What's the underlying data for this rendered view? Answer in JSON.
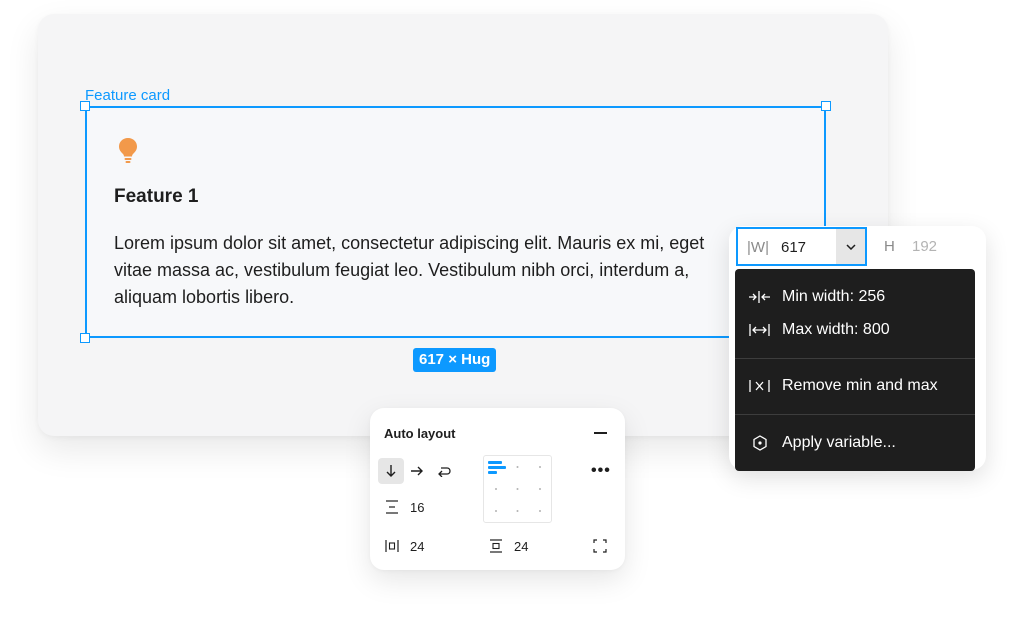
{
  "frame": {
    "label": "Feature card",
    "card_title": "Feature 1",
    "card_body": "Lorem ipsum dolor sit amet, consectetur adipiscing elit. Mauris ex mi, eget vitae massa ac, vestibulum feugiat leo. Vestibulum nibh orci, interdum a, aliquam lobortis libero.",
    "size_badge": "617 × Hug",
    "icon": "lightbulb-icon"
  },
  "dimensions": {
    "width_label": "W",
    "width_value": "617",
    "height_label": "H",
    "height_value": "192"
  },
  "width_menu": {
    "items": [
      {
        "label": "Min width: 256",
        "icon": "min-width-icon"
      },
      {
        "label": "Max width: 800",
        "icon": "max-width-icon"
      },
      {
        "label": "Remove min and max",
        "icon": "remove-min-max-icon"
      },
      {
        "label": "Apply variable...",
        "icon": "variable-icon"
      }
    ]
  },
  "auto_layout": {
    "title": "Auto layout",
    "gap": "16",
    "padding_horizontal": "24",
    "padding_vertical": "24",
    "direction": "vertical"
  },
  "colors": {
    "accent": "#0d99ff",
    "menu_bg": "#1e1e1e",
    "bulb": "#f2994a"
  }
}
